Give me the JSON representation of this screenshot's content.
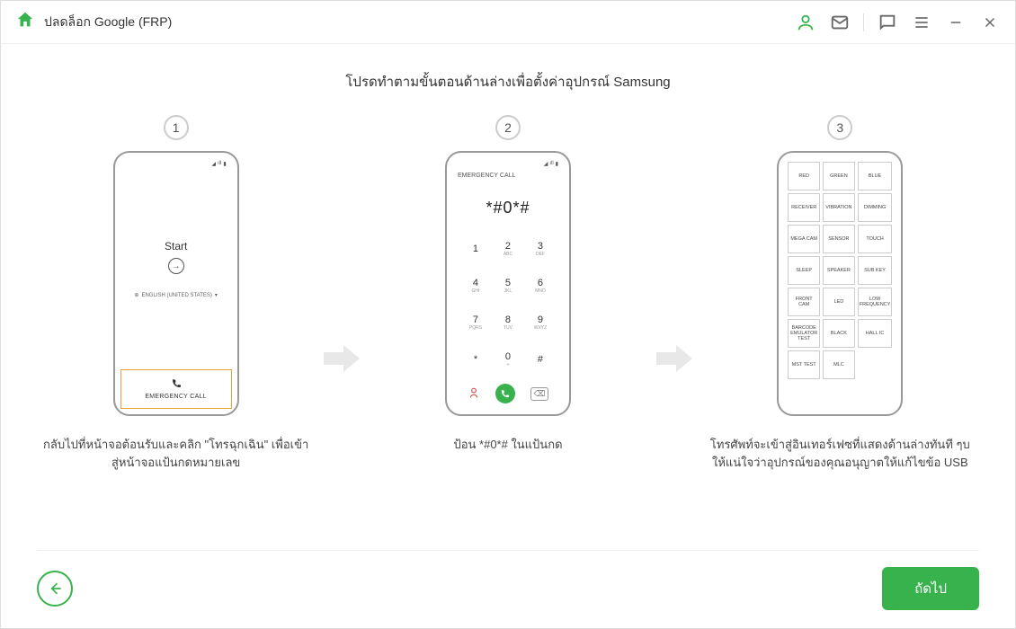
{
  "header": {
    "title": "ปลดล็อก Google (FRP)"
  },
  "instruction_title": "โปรดทำตามขั้นตอนด้านล่างเพื่อตั้งค่าอุปกรณ์ Samsung",
  "steps": {
    "one": {
      "number": "1",
      "phone": {
        "start_label": "Start",
        "language": "ENGLISH (UNITED STATES)",
        "emergency_label": "EMERGENCY CALL"
      },
      "caption": "กลับไปที่หน้าจอต้อนรับและคลิก \"โทรฉุกเฉิน\" เพื่อเข้าสู่หน้าจอแป้นกดหมายเลข"
    },
    "two": {
      "number": "2",
      "phone": {
        "header": "EMERGENCY CALL",
        "display_value": "*#0*#",
        "keypad": [
          {
            "num": "1",
            "sub": ""
          },
          {
            "num": "2",
            "sub": "ABC"
          },
          {
            "num": "3",
            "sub": "DEF"
          },
          {
            "num": "4",
            "sub": "GHI"
          },
          {
            "num": "5",
            "sub": "JKL"
          },
          {
            "num": "6",
            "sub": "MNO"
          },
          {
            "num": "7",
            "sub": "PQRS"
          },
          {
            "num": "8",
            "sub": "TUV"
          },
          {
            "num": "9",
            "sub": "WXYZ"
          },
          {
            "num": "*",
            "sub": ""
          },
          {
            "num": "0",
            "sub": "+"
          },
          {
            "num": "#",
            "sub": ""
          }
        ]
      },
      "caption": "ป้อน *#0*# ในแป้นกด"
    },
    "three": {
      "number": "3",
      "phone": {
        "tiles": [
          "RED",
          "GREEN",
          "BLUE",
          "RECEIVER",
          "VIBRATION",
          "DIMMING",
          "MEGA CAM",
          "SENSOR",
          "TOUCH",
          "SLEEP",
          "SPEAKER",
          "SUB KEY",
          "FRONT CAM",
          "LED",
          "LOW FREQUENCY",
          "BARCODE EMULATOR TEST",
          "BLACK",
          "HALL IC",
          "MST TEST",
          "MLC",
          ""
        ]
      },
      "caption": "โทรศัพท์จะเข้าสู่อินเทอร์เฟซที่แสดงด้านล่างทันที ๆบให้แน่ใจว่าอุปกรณ์ของคุณอนุญาตให้แก้ไขข้อ USB"
    }
  },
  "footer": {
    "next_label": "ถัดไป"
  }
}
